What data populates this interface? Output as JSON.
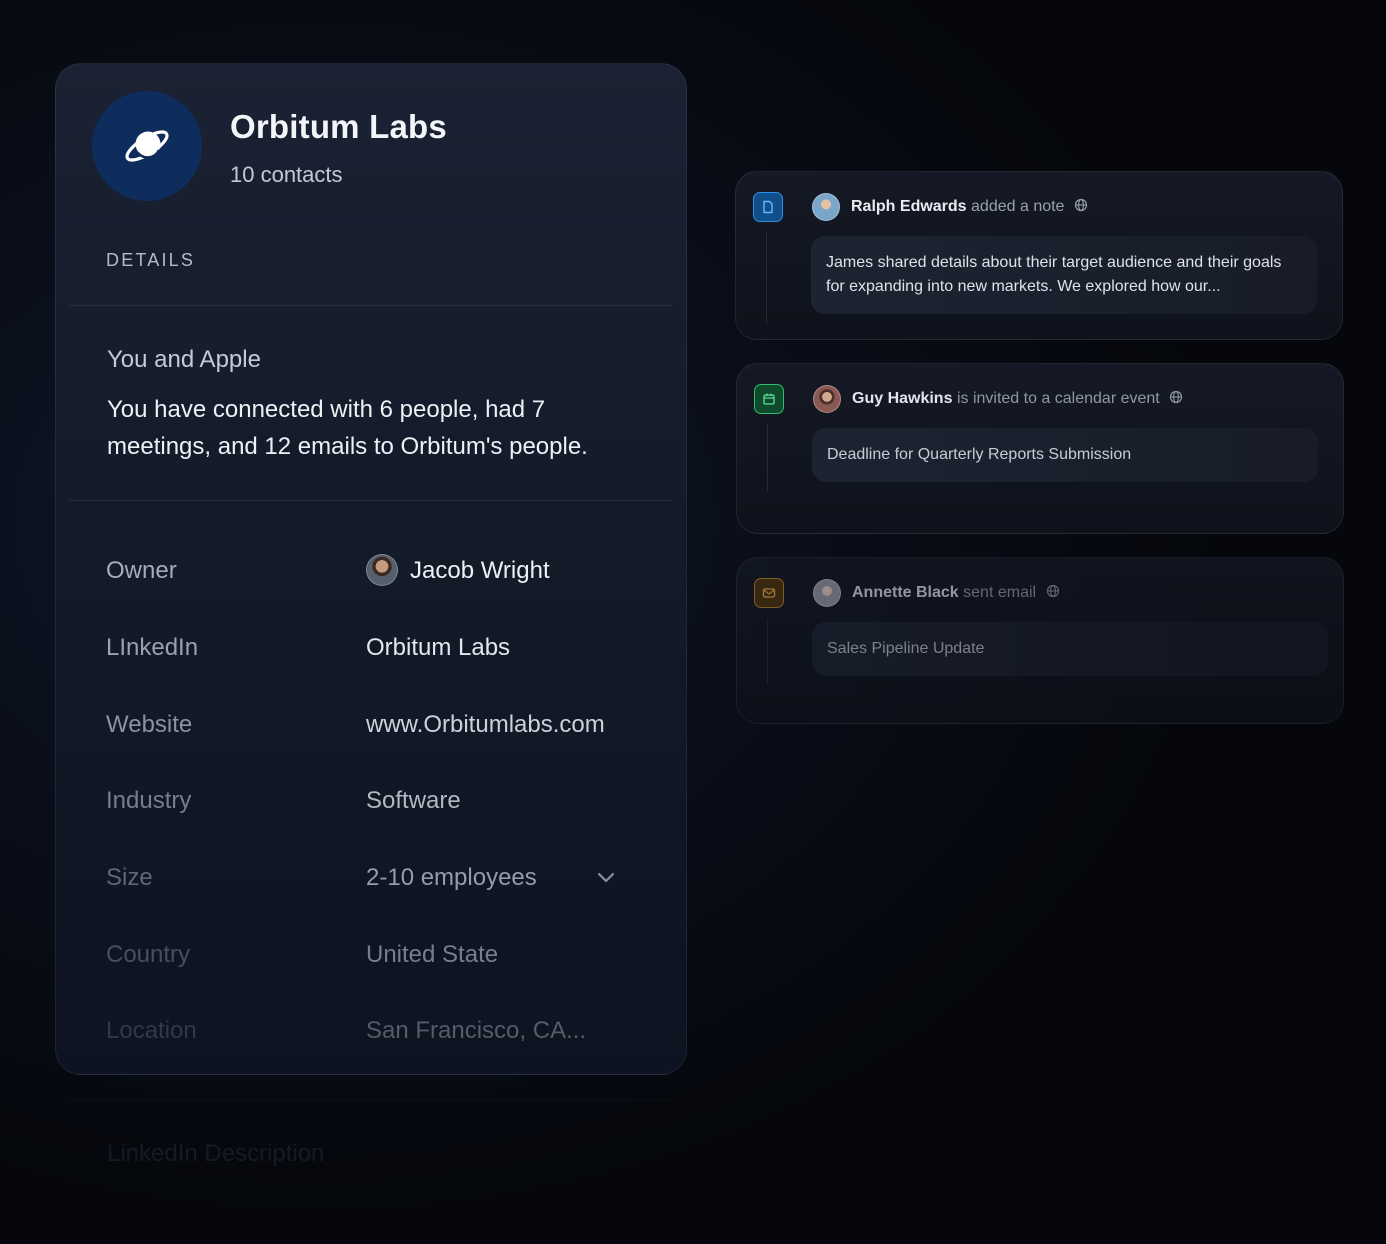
{
  "company": {
    "name": "Orbitum Labs",
    "contacts": "10 contacts",
    "details_label": "DETAILS",
    "summary_title": "You and Apple",
    "summary_text": "You have connected with 6 people, had 7 meetings, and 12 emails to Orbitum's people.",
    "fields": [
      {
        "key": "Owner",
        "value": "Jacob Wright"
      },
      {
        "key": "LInkedIn",
        "value": "Orbitum Labs"
      },
      {
        "key": "Website",
        "value": "www.Orbitumlabs.com"
      },
      {
        "key": "Industry",
        "value": "Software"
      },
      {
        "key": "Size",
        "value": "2-10 employees"
      },
      {
        "key": "Country",
        "value": "United State"
      },
      {
        "key": "Location",
        "value": "San Francisco, CA..."
      }
    ],
    "linkedin_description": "LinkedIn Description"
  },
  "activities": [
    {
      "icon": "note-icon",
      "color": "#2f8fe6",
      "name": "Ralph Edwards",
      "action": "added a note",
      "body": "James shared details about their target audience and their goals for expanding into new markets. We explored how our..."
    },
    {
      "icon": "calendar-icon",
      "color": "#2fbf6f",
      "name": "Guy Hawkins",
      "action": "is invited to a calendar event",
      "body": "Deadline for Quarterly Reports Submission"
    },
    {
      "icon": "mail-icon",
      "color": "#e0a13a",
      "name": "Annette Black",
      "action": "sent email",
      "body": "Sales Pipeline Update"
    }
  ]
}
